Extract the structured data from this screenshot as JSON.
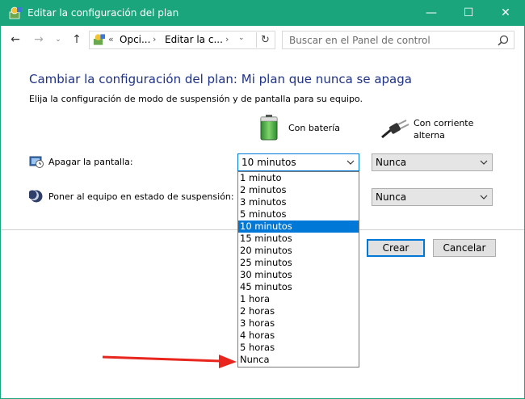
{
  "window": {
    "title": "Editar la configuración del plan",
    "accent": "#1aa57d",
    "controls": {
      "minimize": "—",
      "maximize": "☐",
      "close": "✕"
    }
  },
  "nav": {
    "back": "←",
    "forward": "→",
    "dropdown": "⌄",
    "up": "↑",
    "breadcrumb_prefix": "«",
    "breadcrumb": [
      "Opci...",
      "Editar la c..."
    ],
    "separator": "›",
    "refresh": "↻",
    "search_placeholder": "Buscar en el Panel de control"
  },
  "content": {
    "title": "Cambiar la configuración del plan: Mi plan que nunca se apaga",
    "title_color": "#1e3287",
    "subtitle": "Elija la configuración de modo de suspensión y de pantalla para su equipo.",
    "battery_label": "Con batería",
    "ac_label_line1": "Con corriente",
    "ac_label_line2": "alterna",
    "display_label": "Apagar la pantalla:",
    "sleep_label": "Poner al equipo en estado de suspensión:",
    "display_battery_value": "10 minutos",
    "display_ac_value": "Nunca",
    "sleep_ac_value": "Nunca",
    "create_button": "Crear",
    "cancel_button": "Cancelar"
  },
  "dropdown": {
    "selected_index": 4,
    "options": [
      "1 minuto",
      "2 minutos",
      "3 minutos",
      "5 minutos",
      "10 minutos",
      "15 minutos",
      "20 minutos",
      "25 minutos",
      "30 minutos",
      "45 minutos",
      "1 hora",
      "2 horas",
      "3 horas",
      "4 horas",
      "5 horas",
      "Nunca"
    ],
    "highlight_color": "#0078d7"
  },
  "annotation": {
    "arrow_color": "#e8261e"
  }
}
